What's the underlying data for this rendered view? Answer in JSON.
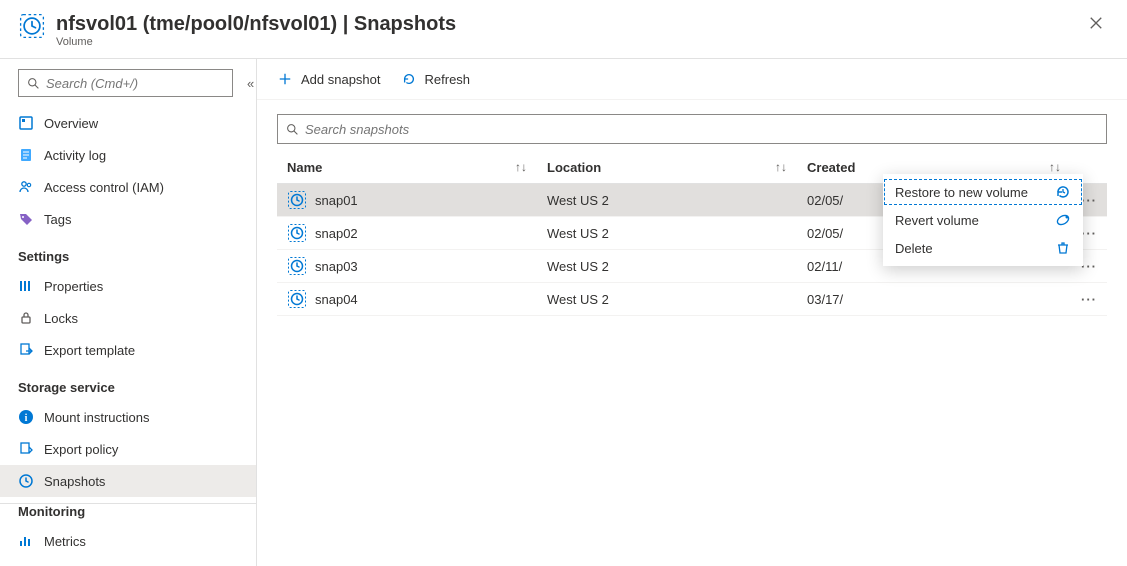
{
  "header": {
    "title": "nfsvol01 (tme/pool0/nfsvol01) | Snapshots",
    "subtitle": "Volume"
  },
  "sidebar": {
    "search_placeholder": "Search (Cmd+/)",
    "groups": [
      {
        "label": null,
        "items": [
          {
            "id": "overview",
            "label": "Overview",
            "icon": "overview-icon"
          },
          {
            "id": "activity-log",
            "label": "Activity log",
            "icon": "log-icon"
          },
          {
            "id": "access-control",
            "label": "Access control (IAM)",
            "icon": "iam-icon"
          },
          {
            "id": "tags",
            "label": "Tags",
            "icon": "tags-icon"
          }
        ]
      },
      {
        "label": "Settings",
        "items": [
          {
            "id": "properties",
            "label": "Properties",
            "icon": "properties-icon"
          },
          {
            "id": "locks",
            "label": "Locks",
            "icon": "lock-icon"
          },
          {
            "id": "export-template",
            "label": "Export template",
            "icon": "export-template-icon"
          }
        ]
      },
      {
        "label": "Storage service",
        "items": [
          {
            "id": "mount-instructions",
            "label": "Mount instructions",
            "icon": "info-icon"
          },
          {
            "id": "export-policy",
            "label": "Export policy",
            "icon": "policy-icon"
          },
          {
            "id": "snapshots",
            "label": "Snapshots",
            "icon": "snapshot-icon",
            "active": true
          }
        ]
      },
      {
        "label": "Monitoring",
        "sep": true,
        "items": [
          {
            "id": "metrics",
            "label": "Metrics",
            "icon": "metrics-icon"
          }
        ]
      }
    ]
  },
  "toolbar": {
    "add_label": "Add snapshot",
    "refresh_label": "Refresh"
  },
  "snapshots": {
    "search_placeholder": "Search snapshots",
    "columns": {
      "name": "Name",
      "location": "Location",
      "created": "Created"
    },
    "rows": [
      {
        "name": "snap01",
        "location": "West US 2",
        "created": "02/05/",
        "selected": true
      },
      {
        "name": "snap02",
        "location": "West US 2",
        "created": "02/05/"
      },
      {
        "name": "snap03",
        "location": "West US 2",
        "created": "02/11/"
      },
      {
        "name": "snap04",
        "location": "West US 2",
        "created": "03/17/"
      }
    ]
  },
  "context_menu": {
    "items": [
      {
        "id": "restore",
        "label": "Restore to new volume",
        "icon": "restore-icon",
        "selected": true
      },
      {
        "id": "revert",
        "label": "Revert volume",
        "icon": "revert-icon"
      },
      {
        "id": "delete",
        "label": "Delete",
        "icon": "delete-icon"
      }
    ]
  }
}
